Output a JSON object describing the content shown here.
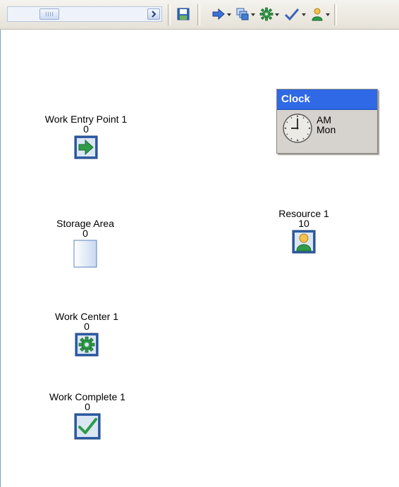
{
  "toolbar": {
    "buttons": [
      {
        "name": "save",
        "icon": "save-icon"
      },
      {
        "name": "work-entry",
        "icon": "arrow-right-icon",
        "dropdown": true
      },
      {
        "name": "storage",
        "icon": "stack-icon",
        "dropdown": true
      },
      {
        "name": "work-center",
        "icon": "gear-icon",
        "dropdown": true
      },
      {
        "name": "work-complete",
        "icon": "checkmark-icon",
        "dropdown": true
      },
      {
        "name": "resource",
        "icon": "person-icon",
        "dropdown": true
      }
    ]
  },
  "canvas": {
    "work_entry": {
      "name": "Work Entry Point 1",
      "count": "0",
      "icon": "arrow-right-icon"
    },
    "storage": {
      "name": "Storage Area",
      "count": "0",
      "icon": "storage-bin-icon"
    },
    "work_center": {
      "name": "Work Center 1",
      "count": "0",
      "icon": "gear-icon"
    },
    "work_complete": {
      "name": "Work Complete 1",
      "count": "0",
      "icon": "checkmark-icon"
    },
    "resource": {
      "name": "Resource 1",
      "count": "10",
      "icon": "person-icon"
    },
    "clock": {
      "title": "Clock",
      "ampm": "AM",
      "day": "Mon"
    }
  },
  "colors": {
    "accent": "#2f69e6",
    "icon_frame": "#2f5fa8",
    "arrow_green": "#2f9b48"
  }
}
